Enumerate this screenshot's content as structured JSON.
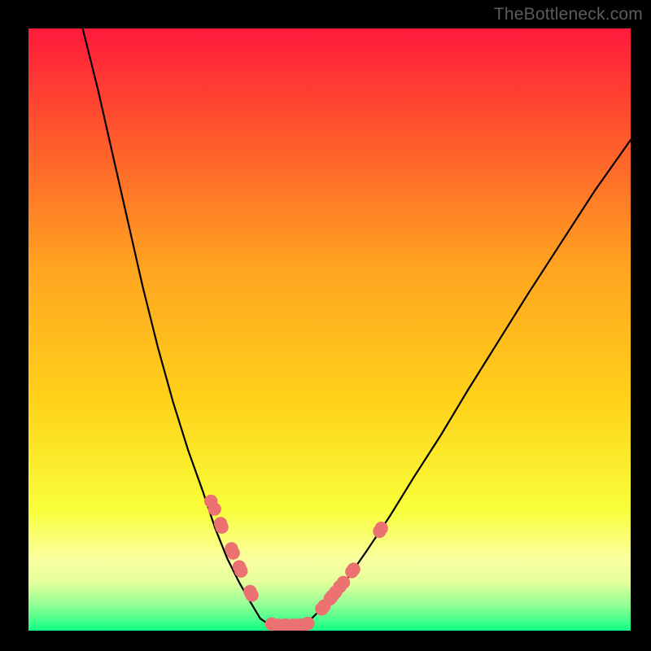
{
  "watermark": "TheBottleneck.com",
  "colors": {
    "frame_bg": "#000000",
    "grad_top": "#ff1a3c",
    "grad_mid": "#ffd21a",
    "grad_yellowband": "#faffa2",
    "grad_bottom": "#12ff85",
    "curve": "#000000",
    "marker": "#ec7272"
  },
  "chart_data": {
    "type": "line",
    "title": "",
    "xlabel": "",
    "ylabel": "",
    "xlim": [
      0,
      100
    ],
    "ylim": [
      0,
      100
    ],
    "curve_left": {
      "comment": "x percent along width, y percent (0 = bottom)",
      "x": [
        9.0,
        11.5,
        14.0,
        16.5,
        19.0,
        21.5,
        24.0,
        26.5,
        29.0,
        31.0,
        33.0,
        35.0,
        37.0,
        38.5,
        40.0
      ],
      "y": [
        100.0,
        90.0,
        79.0,
        68.0,
        57.0,
        47.0,
        38.0,
        30.0,
        23.0,
        17.0,
        12.0,
        8.0,
        4.5,
        2.0,
        1.0
      ]
    },
    "curve_flat": {
      "x": [
        40.0,
        41.5,
        43.0,
        44.5,
        46.0
      ],
      "y": [
        1.0,
        0.9,
        0.9,
        0.9,
        1.0
      ]
    },
    "curve_right": {
      "x": [
        46.0,
        49.0,
        52.5,
        56.0,
        60.0,
        64.0,
        68.5,
        73.0,
        78.0,
        83.0,
        88.5,
        94.0,
        100.0
      ],
      "y": [
        1.0,
        4.0,
        8.0,
        13.0,
        19.0,
        25.5,
        32.5,
        40.0,
        48.0,
        56.0,
        64.5,
        73.0,
        81.5
      ]
    },
    "marker_points": {
      "comment": "salmon dots along the curve, x/y in percent (0 = bottom for y)",
      "x": [
        30.3,
        30.9,
        31.9,
        32.1,
        33.7,
        34.0,
        35.0,
        35.3,
        36.8,
        37.1,
        40.4,
        41.4,
        42.4,
        42.8,
        43.8,
        44.1,
        44.8,
        45.4,
        46.1,
        46.4,
        48.7,
        49.1,
        48.8,
        50.1,
        50.4,
        51.0,
        51.7,
        52.3,
        53.7,
        54.0,
        58.3,
        58.6
      ],
      "y": [
        21.5,
        20.2,
        17.8,
        17.2,
        13.6,
        12.9,
        10.6,
        9.9,
        6.5,
        5.9,
        1.1,
        0.9,
        0.9,
        0.9,
        0.9,
        0.9,
        0.9,
        0.9,
        1.1,
        1.2,
        3.6,
        4.1,
        3.7,
        5.3,
        5.7,
        6.4,
        7.3,
        8.0,
        9.8,
        10.2,
        16.5,
        17.0
      ]
    }
  }
}
